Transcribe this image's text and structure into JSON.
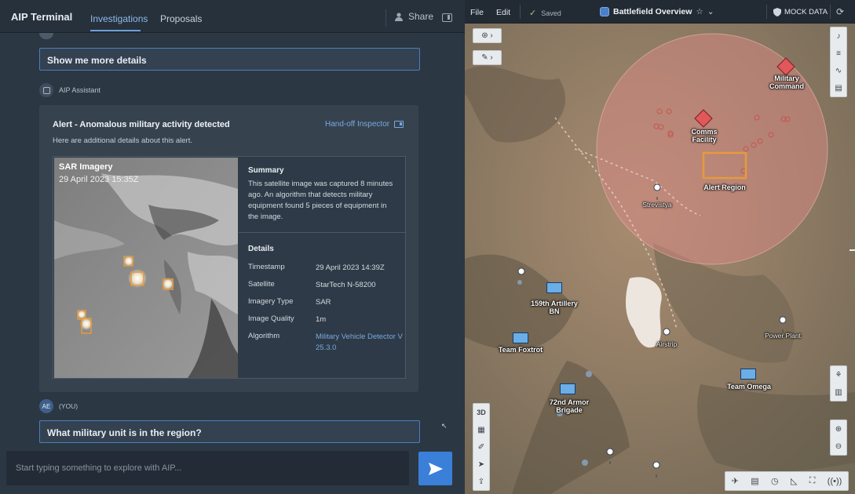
{
  "header": {
    "app_title": "AIP Terminal",
    "tabs": [
      {
        "label": "Investigations",
        "active": true
      },
      {
        "label": "Proposals",
        "active": false
      }
    ],
    "share_label": "Share"
  },
  "chat": {
    "messages": [
      {
        "role": "user",
        "text": "Show me more details"
      },
      {
        "role": "assistant",
        "sender": "AIP Assistant"
      },
      {
        "role": "user",
        "sender_initials": "AE",
        "sender_label": "(YOU)",
        "text": "What military unit is in the region?"
      }
    ],
    "alert_card": {
      "title": "Alert - Anomalous military activity detected",
      "action_label": "Hand-off Inspector",
      "subtitle": "Here are additional details about this alert.",
      "image": {
        "title": "SAR Imagery",
        "date": "29 April 2023 15:35Z"
      },
      "summary_heading": "Summary",
      "summary_text": "This satellite image was captured 8 minutes ago. An algorithm that detects military equipment found 5 pieces of equipment in the image.",
      "details_heading": "Details",
      "details": [
        {
          "key": "Timestamp",
          "value": "29 April 2023 14:39Z"
        },
        {
          "key": "Satellite",
          "value": "StarTech N-58200"
        },
        {
          "key": "Imagery Type",
          "value": "SAR"
        },
        {
          "key": "Image Quality",
          "value": "1m"
        },
        {
          "key": "Algorithm",
          "value": "Military Vehicle Detector V 25.3.0"
        }
      ]
    },
    "composer_placeholder": "Start typing something to explore with AIP..."
  },
  "map_panel": {
    "menu": [
      "File",
      "Edit"
    ],
    "saved_label": "Saved",
    "title": "Battlefield Overview",
    "mock_label": "MOCK DATA",
    "left_toolbar": [
      "3D"
    ],
    "labels": {
      "military_command": "Military Command",
      "comms_facility": "Comms Facility",
      "alert_region": "Alert Region",
      "strevistya": "Strevistya",
      "artillery": "159th Artillery BN",
      "team_foxtrot": "Team Foxtrot",
      "airstrip": "Airstrip",
      "power_plant": "Power Plant",
      "team_omega": "Team Omega",
      "armor_brigade": "72nd Armor Brigade"
    },
    "colors": {
      "threat": "#e05050",
      "friendly_unit": "#6aaee8",
      "alert_box": "#e79a3c",
      "accent": "#3a7fd8"
    }
  }
}
